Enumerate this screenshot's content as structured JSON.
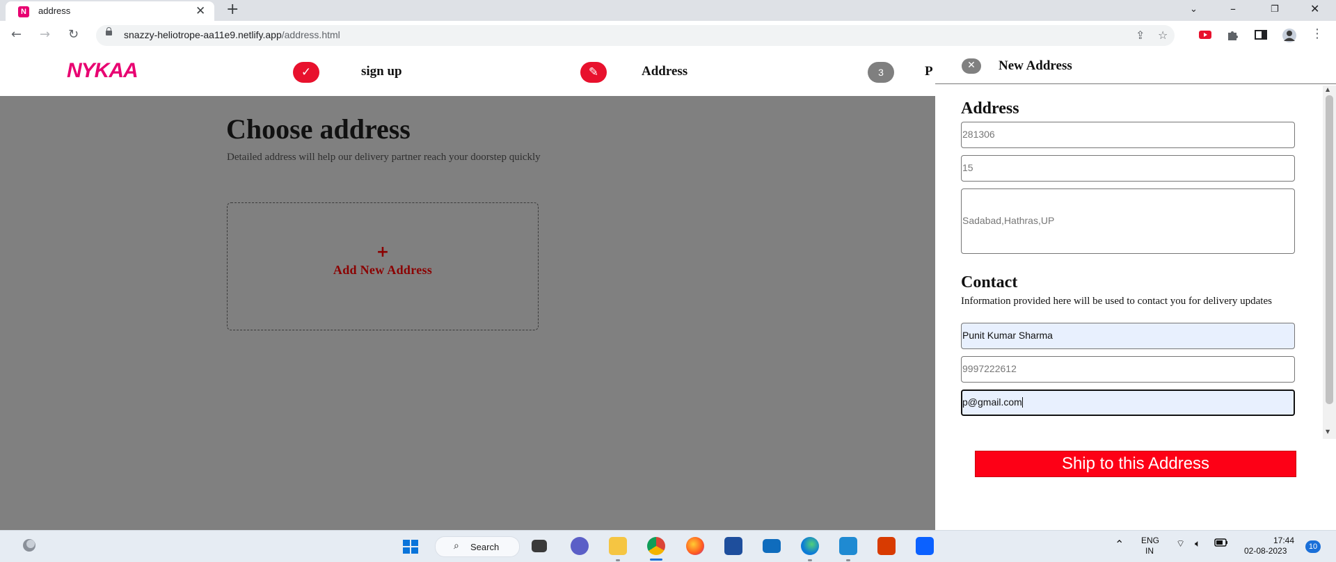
{
  "browser": {
    "tab_title": "address",
    "tab_favicon": "N",
    "url_host": "snazzy-heliotrope-aa11e9.netlify.app",
    "url_path": "/address.html"
  },
  "header": {
    "logo": "NYKAA",
    "steps": [
      {
        "icon": "check-icon",
        "glyph": "✓",
        "label": "sign up"
      },
      {
        "icon": "pencil-icon",
        "glyph": "✎",
        "label": "Address"
      },
      {
        "number": "3",
        "label": "P"
      }
    ]
  },
  "main": {
    "title": "Choose address",
    "subtitle": "Detailed address will help our delivery partner reach your doorstep quickly",
    "add_card": {
      "plus": "+",
      "label": "Add New Address"
    }
  },
  "drawer": {
    "close_glyph": "✕",
    "title": "New Address",
    "address_section": {
      "title": "Address",
      "pincode": "281306",
      "house": "15",
      "area": "Sadabad,Hathras,UP"
    },
    "contact_section": {
      "title": "Contact",
      "note": "Information provided here will be used to contact you for delivery updates",
      "name": "Punit Kumar Sharma",
      "phone": "9997222612",
      "email": "p@gmail.com"
    },
    "submit_label": "Ship to this Address"
  },
  "taskbar": {
    "search_label": "Search",
    "language_top": "ENG",
    "language_bottom": "IN",
    "time": "17:44",
    "date": "02-08-2023",
    "notification_count": "10"
  },
  "colors": {
    "brand": "#e80071",
    "accent_red": "#fd0016",
    "overlay": "#808080"
  }
}
